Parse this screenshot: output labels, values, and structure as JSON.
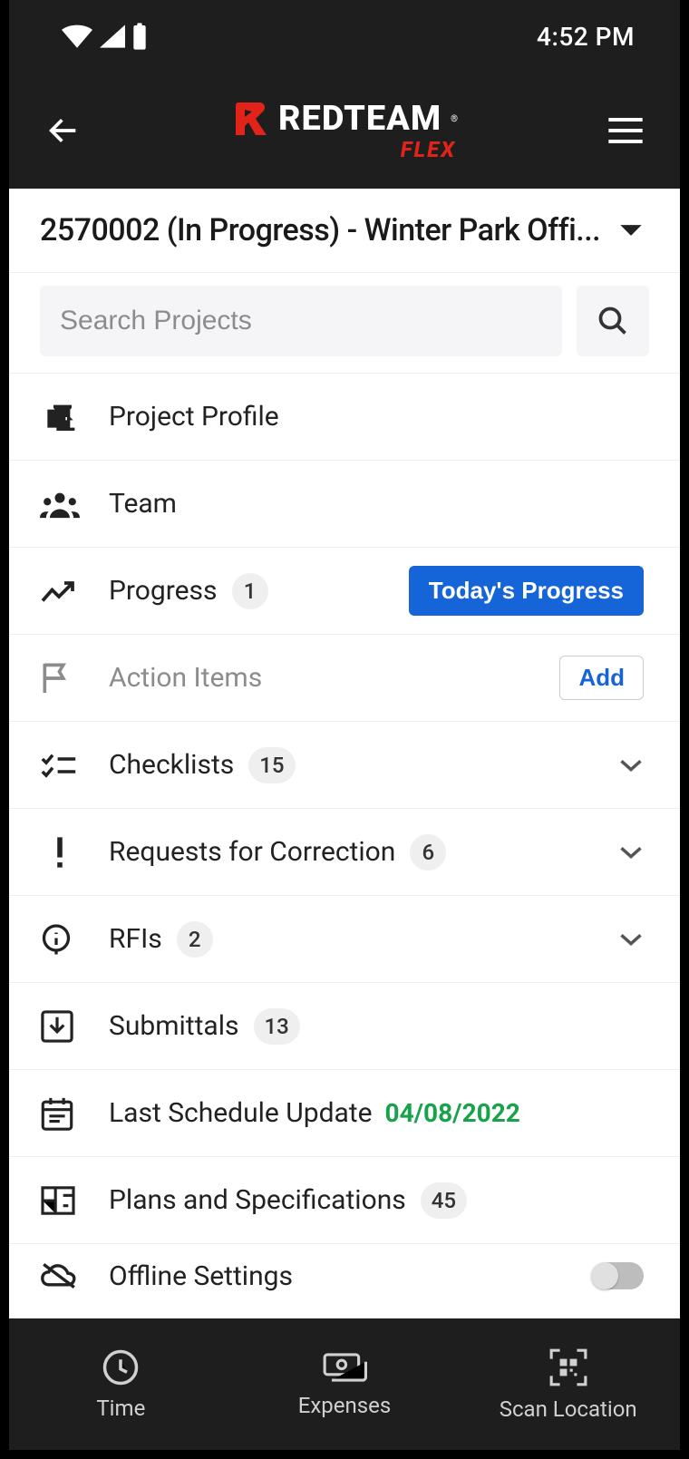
{
  "status": {
    "time": "4:52 PM"
  },
  "logo": {
    "brand": "REDTEAM",
    "sub": "FLEX"
  },
  "project": {
    "title": "2570002 (In Progress) - Winter Park Offi..."
  },
  "search": {
    "placeholder": "Search Projects"
  },
  "rows": {
    "profile": {
      "label": "Project Profile"
    },
    "team": {
      "label": "Team"
    },
    "progress": {
      "label": "Progress",
      "badge": "1",
      "button": "Today's Progress"
    },
    "action": {
      "label": "Action Items",
      "button": "Add"
    },
    "checklists": {
      "label": "Checklists",
      "badge": "15"
    },
    "rfc": {
      "label": "Requests for Correction",
      "badge": "6"
    },
    "rfis": {
      "label": "RFIs",
      "badge": "2"
    },
    "submittals": {
      "label": "Submittals",
      "badge": "13"
    },
    "schedule": {
      "label": "Last Schedule Update",
      "date": "04/08/2022"
    },
    "plans": {
      "label": "Plans and Specifications",
      "badge": "45"
    },
    "offline": {
      "label": "Offline Settings"
    }
  },
  "bottom": {
    "time": "Time",
    "expenses": "Expenses",
    "scan": "Scan Location"
  }
}
